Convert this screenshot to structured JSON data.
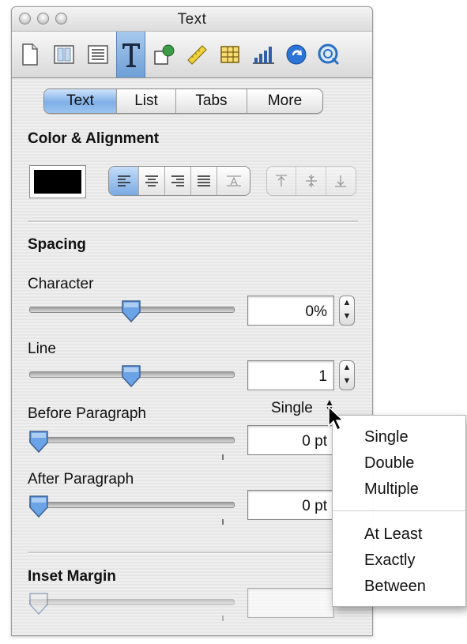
{
  "window": {
    "title": "Text",
    "toolbar": [
      {
        "icon": "document-icon"
      },
      {
        "icon": "layout-icon"
      },
      {
        "icon": "wrap-icon"
      },
      {
        "icon": "text-icon",
        "selected": true
      },
      {
        "icon": "graphic-icon"
      },
      {
        "icon": "metrics-icon"
      },
      {
        "icon": "table-icon"
      },
      {
        "icon": "chart-icon"
      },
      {
        "icon": "hyperlink-icon"
      },
      {
        "icon": "quicktime-icon"
      }
    ]
  },
  "tabs": [
    "Text",
    "List",
    "Tabs",
    "More"
  ],
  "selected_tab": "Text",
  "color_alignment": {
    "heading": "Color & Alignment",
    "color": "#000000",
    "horizontal_alignment": [
      "align-left-icon",
      "align-center-icon",
      "align-right-icon",
      "justify-icon",
      "auto-align-icon"
    ],
    "selected_alignment": "align-left-icon",
    "vertical_alignment": [
      "align-top-icon",
      "align-middle-icon",
      "align-bottom-icon"
    ]
  },
  "spacing": {
    "heading": "Spacing",
    "character": {
      "label": "Character",
      "value": "0%",
      "slider_level": 0.5
    },
    "line": {
      "label": "Line",
      "value": "1",
      "slider_level": 0.5,
      "mode": "Single"
    },
    "before_paragraph": {
      "label": "Before Paragraph",
      "value": "0 pt",
      "slider_level": 0.0
    },
    "after_paragraph": {
      "label": "After Paragraph",
      "value": "0 pt",
      "slider_level": 0.0
    }
  },
  "inset_margin": {
    "heading": "Inset Margin",
    "slider_level": 0.0
  },
  "line_spacing_menu": {
    "group1": [
      "Single",
      "Double",
      "Multiple"
    ],
    "group2": [
      "At Least",
      "Exactly",
      "Between"
    ]
  }
}
